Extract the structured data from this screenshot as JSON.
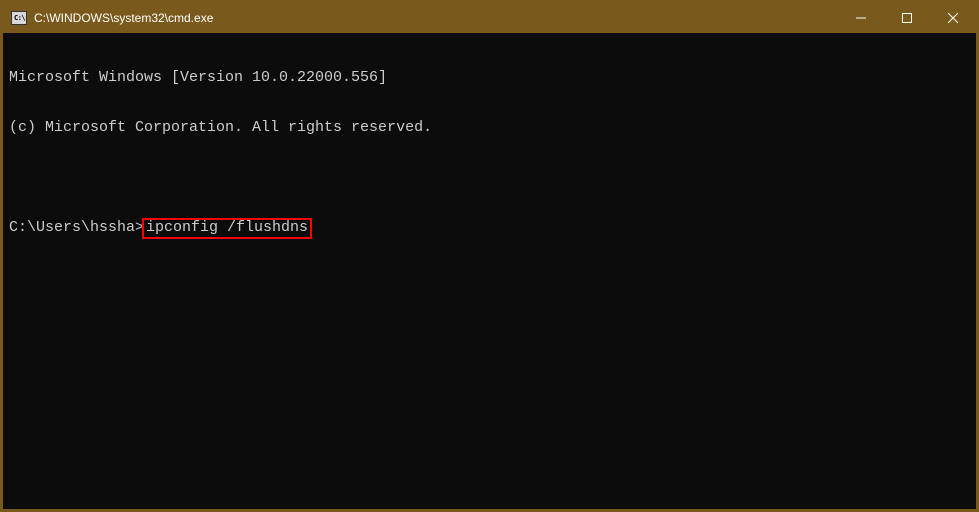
{
  "window": {
    "title": "C:\\WINDOWS\\system32\\cmd.exe",
    "icon_label": "cmd-icon"
  },
  "terminal": {
    "line1": "Microsoft Windows [Version 10.0.22000.556]",
    "line2": "(c) Microsoft Corporation. All rights reserved.",
    "prompt": "C:\\Users\\hssha>",
    "command": "ipconfig /flushdns",
    "highlight_color": "#ff0000"
  },
  "titlebar": {
    "background": "#7a5a1c"
  }
}
